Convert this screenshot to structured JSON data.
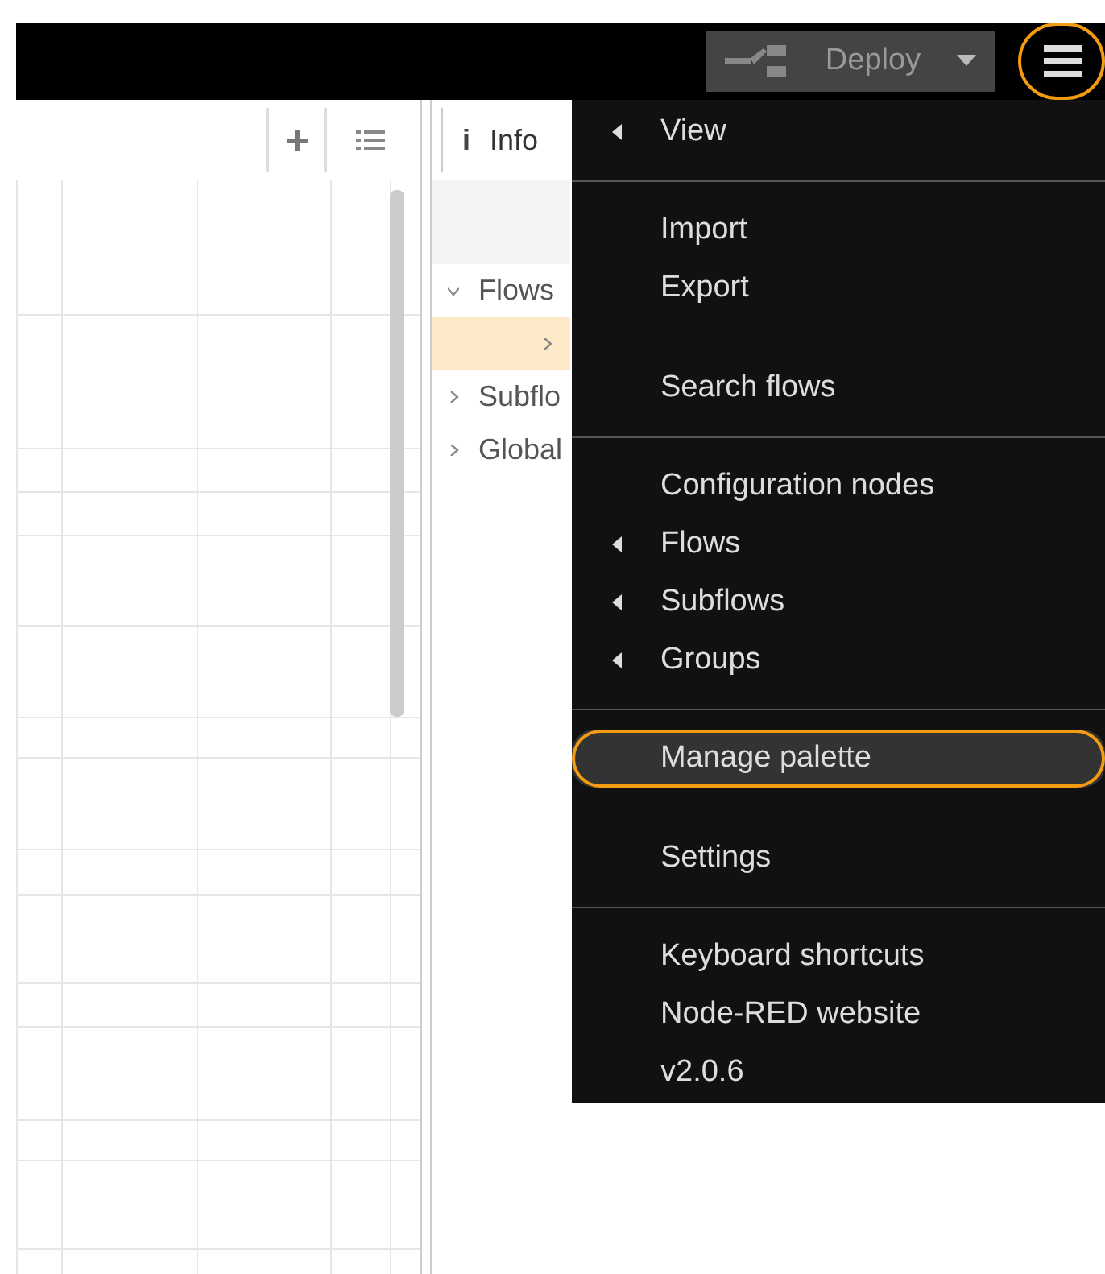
{
  "header": {
    "deploy_button": {
      "label": "Deploy"
    },
    "menu_button": {
      "annotated": true
    }
  },
  "sidebar": {
    "tab": {
      "label": "Info",
      "icon": "i"
    },
    "tree": [
      {
        "label": "Flows",
        "expanded": true,
        "children": [
          {
            "selected": true
          }
        ]
      },
      {
        "label": "Subflo",
        "expanded": false
      },
      {
        "label": "Global",
        "expanded": false
      }
    ]
  },
  "menu": {
    "items": [
      {
        "kind": "submenu",
        "label": "View",
        "highlighted": false,
        "annotated": false
      },
      {
        "kind": "divider"
      },
      {
        "kind": "item",
        "label": "Import",
        "highlighted": false,
        "annotated": false
      },
      {
        "kind": "item",
        "label": "Export",
        "highlighted": false,
        "annotated": false
      },
      {
        "kind": "spacer"
      },
      {
        "kind": "item",
        "label": "Search flows",
        "highlighted": false,
        "annotated": false
      },
      {
        "kind": "divider"
      },
      {
        "kind": "item",
        "label": "Configuration nodes",
        "highlighted": false,
        "annotated": false
      },
      {
        "kind": "submenu",
        "label": "Flows",
        "highlighted": false,
        "annotated": false
      },
      {
        "kind": "submenu",
        "label": "Subflows",
        "highlighted": false,
        "annotated": false
      },
      {
        "kind": "submenu",
        "label": "Groups",
        "highlighted": false,
        "annotated": false
      },
      {
        "kind": "divider"
      },
      {
        "kind": "item",
        "label": "Manage palette",
        "highlighted": true,
        "annotated": true
      },
      {
        "kind": "spacer"
      },
      {
        "kind": "item",
        "label": "Settings",
        "highlighted": false,
        "annotated": false
      },
      {
        "kind": "divider"
      },
      {
        "kind": "item",
        "label": "Keyboard shortcuts",
        "highlighted": false,
        "annotated": false
      },
      {
        "kind": "item",
        "label": "Node-RED website",
        "highlighted": false,
        "annotated": false
      },
      {
        "kind": "item",
        "label": "v2.0.6",
        "highlighted": false,
        "annotated": false
      }
    ]
  }
}
